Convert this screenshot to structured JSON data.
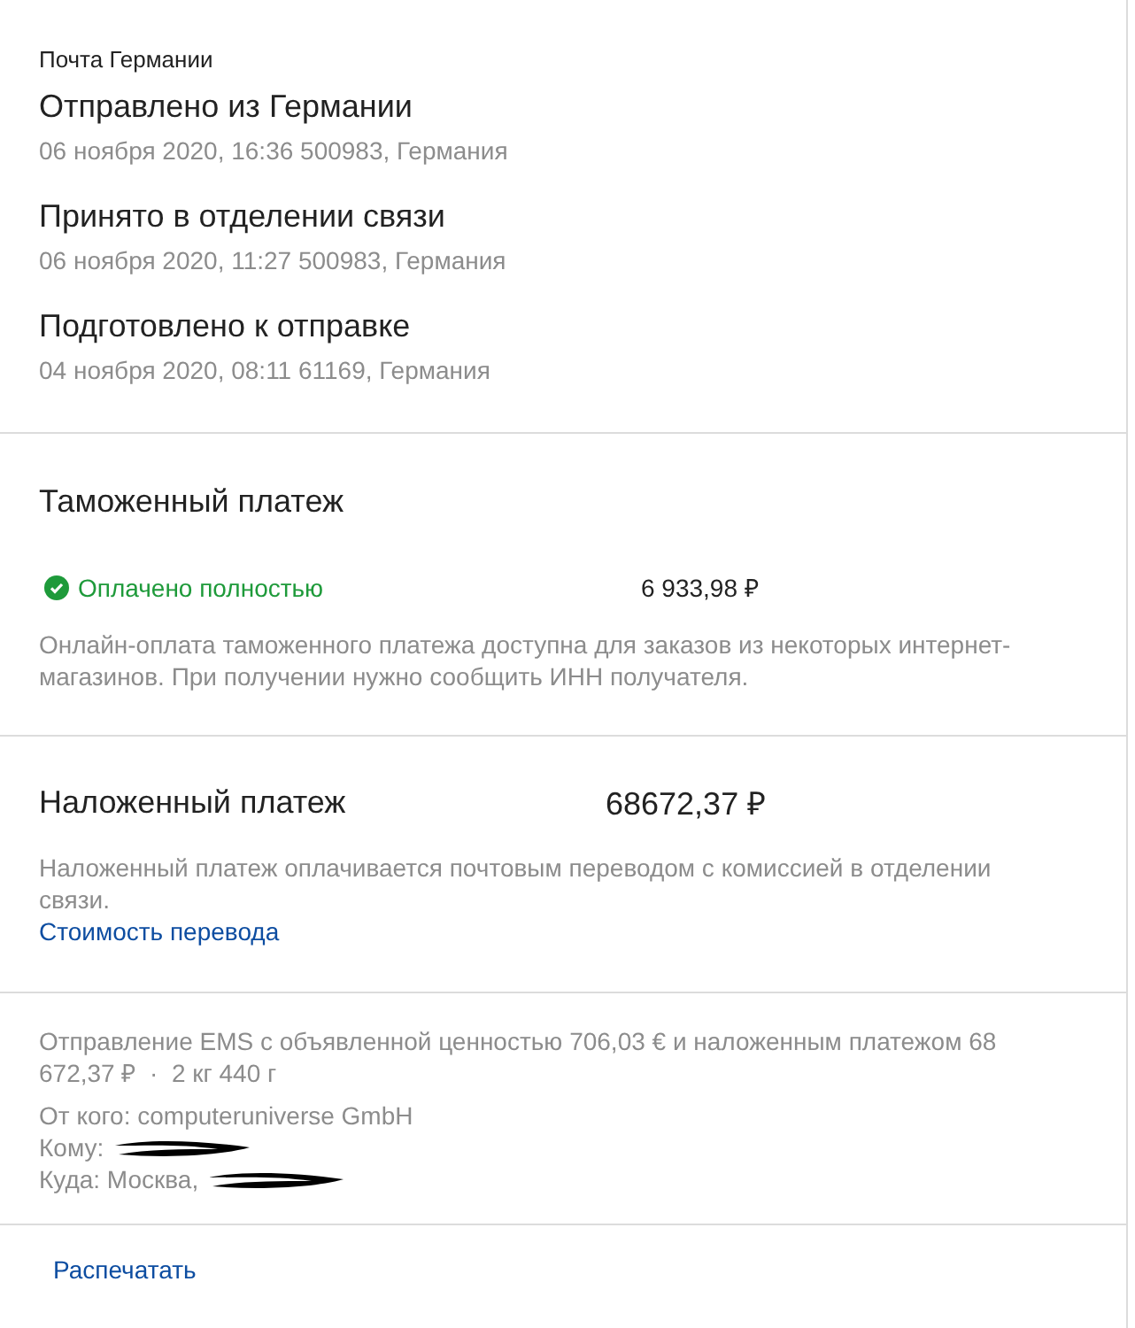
{
  "tracking": {
    "carrier": "Почта Германии",
    "events": [
      {
        "title": "Отправлено из Германии",
        "details": "06 ноября 2020, 16:36 500983, Германия"
      },
      {
        "title": "Принято в отделении связи",
        "details": "06 ноября 2020, 11:27 500983, Германия"
      },
      {
        "title": "Подготовлено к отправке",
        "details": "04 ноября 2020, 08:11 61169, Германия"
      }
    ]
  },
  "customs": {
    "title": "Таможенный платеж",
    "status": {
      "label": "Оплачено полностью",
      "paid": true
    },
    "amount": "6 933,98 ₽",
    "note": "Онлайн-оплата таможенного платежа доступна для заказов из некоторых интернет-магазинов. При получении нужно сообщить ИНН получателя."
  },
  "cod": {
    "title": "Наложенный платеж",
    "amount": "68672,37 ₽",
    "note": "Наложенный платеж оплачивается почтовым переводом с комиссией в отделении связи.",
    "link": "Стоимость перевода"
  },
  "shipment": {
    "description": "Отправление EMS с объявленной ценностью 706,03 € и наложенным платежом 68 672,37 ₽",
    "separator": "·",
    "weight": "2 кг 440 г",
    "lines": [
      {
        "text": "От кого: computeruniverse GmbH",
        "redacted": false
      },
      {
        "text": "Кому:",
        "redacted": true
      },
      {
        "text": "Куда: Москва,",
        "redacted": true
      }
    ]
  },
  "print_link": "Распечатать"
}
